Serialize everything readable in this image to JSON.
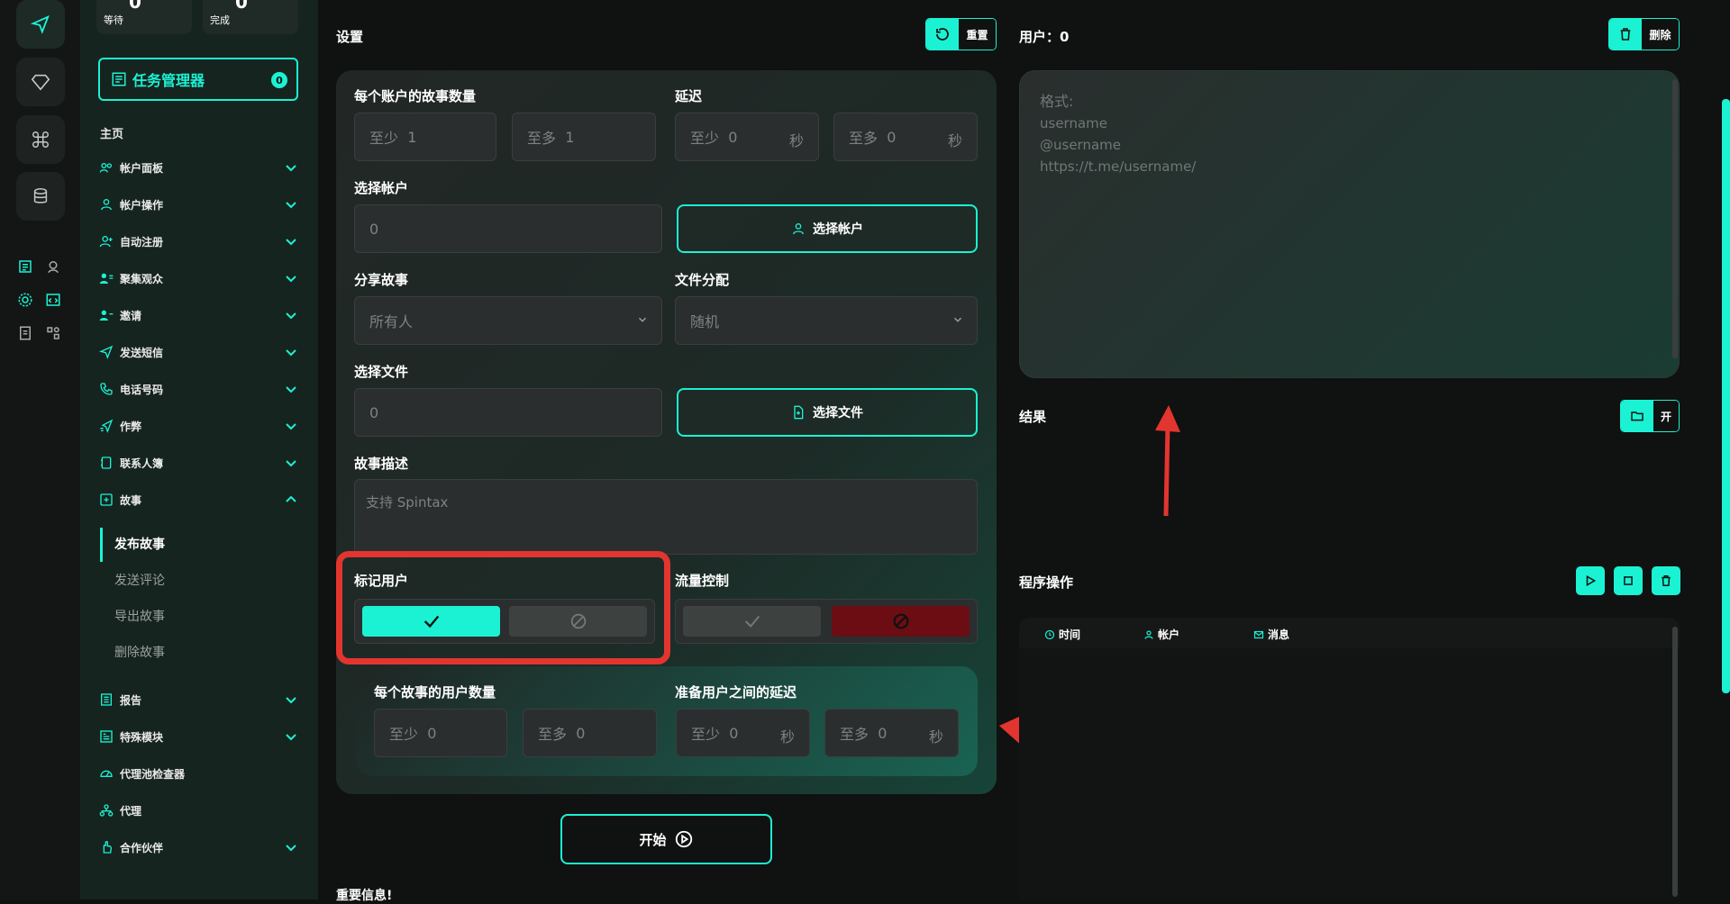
{
  "stats": {
    "waiting": {
      "value": "0",
      "label": "等待"
    },
    "done": {
      "value": "0",
      "label": "完成"
    }
  },
  "sidebar": {
    "task_manager": "任务管理器",
    "task_badge": "0",
    "home": "主页",
    "items": [
      {
        "label": "帐户面板"
      },
      {
        "label": "帐户操作"
      },
      {
        "label": "自动注册"
      },
      {
        "label": "聚集观众"
      },
      {
        "label": "邀请"
      },
      {
        "label": "发送短信"
      },
      {
        "label": "电话号码"
      },
      {
        "label": "作弊"
      },
      {
        "label": "联系人簿"
      },
      {
        "label": "故事"
      },
      {
        "label": "报告"
      },
      {
        "label": "特殊模块"
      },
      {
        "label": "代理池检查器"
      },
      {
        "label": "代理"
      },
      {
        "label": "合作伙伴"
      }
    ],
    "story_sub": [
      "发布故事",
      "发送评论",
      "导出故事",
      "删除故事"
    ]
  },
  "settings": {
    "title": "设置",
    "reset": "重置",
    "stories_per_account": "每个账户的故事数量",
    "min_label": "至少",
    "max_label": "至多",
    "stories_min": "1",
    "stories_max": "1",
    "delay": "延迟",
    "delay_min": "0",
    "delay_max": "0",
    "sec": "秒",
    "select_account": "选择帐户",
    "account_value": "0",
    "select_account_btn": "选择帐户",
    "share_story": "分享故事",
    "share_value": "所有人",
    "file_dist": "文件分配",
    "file_dist_value": "随机",
    "select_file": "选择文件",
    "file_value": "0",
    "select_file_btn": "选择文件",
    "story_desc": "故事描述",
    "story_desc_placeholder": "支持 Spintax",
    "mark_users": "标记用户",
    "flow_control": "流量控制",
    "users_per_story": "每个故事的用户数量",
    "users_min": "0",
    "users_max": "0",
    "delay_between": "准备用户之间的延迟",
    "db_min": "0",
    "db_max": "0",
    "start": "开始",
    "important": "重要信息!"
  },
  "users": {
    "title": "用户：0",
    "delete": "删除",
    "format_lines": [
      "格式:",
      "username",
      "@username",
      "https://t.me/username/"
    ]
  },
  "result": {
    "title": "结果",
    "open": "开"
  },
  "ops": {
    "title": "程序操作",
    "col_time": "时间",
    "col_account": "帐户",
    "col_message": "消息"
  },
  "colors": {
    "accent": "#1bf2d3",
    "annotation": "#e3352f",
    "stop": "#6b0d13"
  }
}
